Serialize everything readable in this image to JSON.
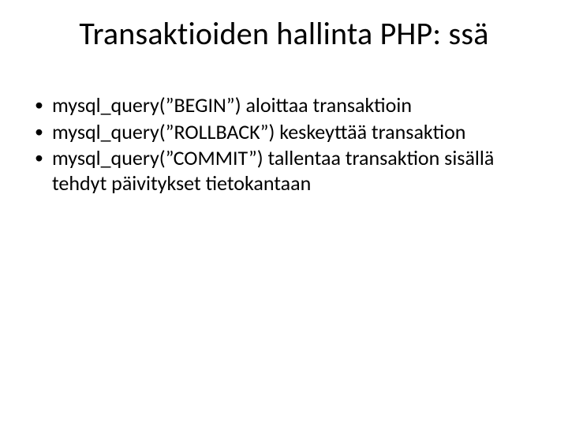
{
  "title": "Transaktioiden hallinta PHP: ssä",
  "bullets": [
    "mysql_query(”BEGIN”) aloittaa transaktioin",
    "mysql_query(”ROLLBACK”) keskeyttää transaktion",
    "mysql_query(”COMMIT”) tallentaa transaktion sisällä tehdyt päivitykset tietokantaan"
  ]
}
